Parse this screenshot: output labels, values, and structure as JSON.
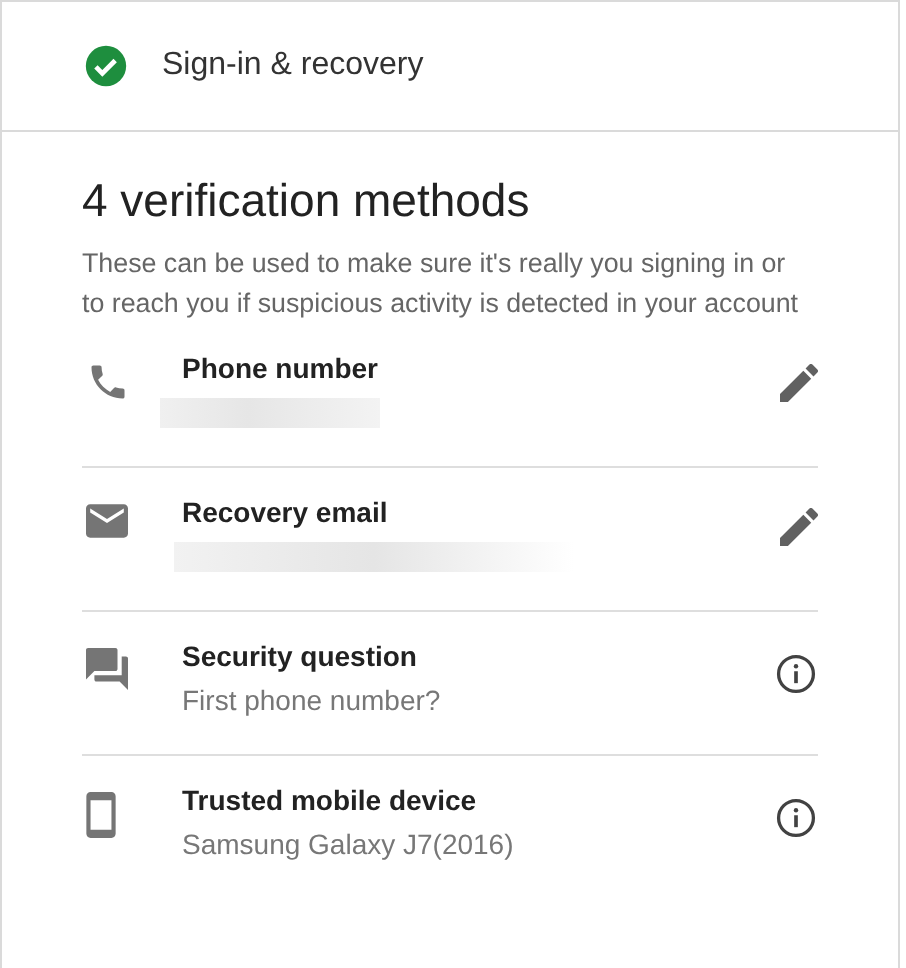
{
  "header": {
    "title": "Sign-in & recovery"
  },
  "heading": "4 verification methods",
  "description": "These can be used to make sure it's really you signing in or to reach you if suspicious activity is detected in your account",
  "methods": [
    {
      "title": "Phone number"
    },
    {
      "title": "Recovery email"
    },
    {
      "title": "Security question",
      "value": "First phone number?"
    },
    {
      "title": "Trusted mobile device",
      "value": "Samsung Galaxy J7(2016)"
    }
  ]
}
